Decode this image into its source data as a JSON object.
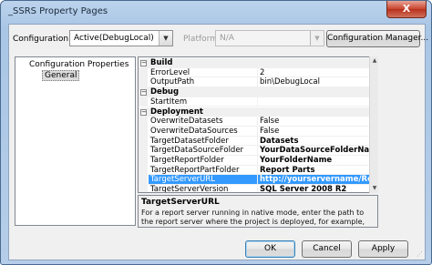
{
  "window": {
    "title": "_SSRS Property Pages",
    "close_glyph": "X"
  },
  "configuration": {
    "label": "Configuration:",
    "value": "Active(DebugLocal)"
  },
  "platform": {
    "label": "Platform:",
    "value": "N/A"
  },
  "config_manager_label": "Configuration Manager...",
  "tree": {
    "root": "Configuration Properties",
    "child": "General"
  },
  "grid": {
    "categories": [
      {
        "name": "Build",
        "toggle": "−",
        "rows": [
          {
            "name": "ErrorLevel",
            "value": "2",
            "bold": false
          },
          {
            "name": "OutputPath",
            "value": "bin\\DebugLocal",
            "bold": false
          }
        ]
      },
      {
        "name": "Debug",
        "toggle": "−",
        "rows": [
          {
            "name": "StartItem",
            "value": "",
            "bold": false
          }
        ]
      },
      {
        "name": "Deployment",
        "toggle": "−",
        "rows": [
          {
            "name": "OverwriteDatasets",
            "value": "False",
            "bold": false
          },
          {
            "name": "OverwriteDataSources",
            "value": "False",
            "bold": false
          },
          {
            "name": "TargetDatasetFolder",
            "value": "Datasets",
            "bold": true
          },
          {
            "name": "TargetDataSourceFolder",
            "value": "YourDataSourceFolderName",
            "bold": true
          },
          {
            "name": "TargetReportFolder",
            "value": "YourFolderName",
            "bold": true
          },
          {
            "name": "TargetReportPartFolder",
            "value": "Report Parts",
            "bold": true
          },
          {
            "name": "TargetServerURL",
            "value": "http://yourservername/ReportServer",
            "bold": true,
            "selected": true
          },
          {
            "name": "TargetServerVersion",
            "value": "SQL Server 2008 R2",
            "bold": true
          }
        ]
      }
    ]
  },
  "description": {
    "title": "TargetServerURL",
    "text": "For a report server running in native mode, enter the path to the report server where the project is deployed, for example, http://<servername>/reportserver. F..."
  },
  "buttons": {
    "ok": "OK",
    "cancel": "Cancel",
    "apply": "Apply"
  },
  "colors": {
    "selection": "#3399ff",
    "window_frame": "#a9c6e6",
    "close": "#c8432d"
  },
  "icons": {
    "combo_arrow": "▼",
    "scroll_up": "▲",
    "scroll_down": "▼"
  }
}
